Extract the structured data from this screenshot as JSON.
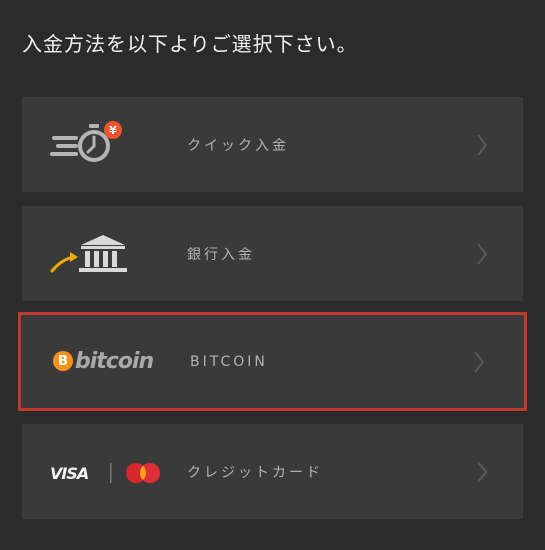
{
  "header": {
    "title": "入金方法を以下よりご選択下さい。"
  },
  "options": [
    {
      "label": "クイック入金",
      "icon": "quick-deposit-timer-yen-icon",
      "selected": false
    },
    {
      "label": "銀行入金",
      "icon": "bank-transfer-icon",
      "selected": false
    },
    {
      "label": "BITCOIN",
      "icon": "bitcoin-logo",
      "selected": true,
      "logo_symbol": "B",
      "logo_text": "bitcoin"
    },
    {
      "label": "クレジットカード",
      "icon": "visa-mastercard-icon",
      "selected": false,
      "visa_text": "VISA"
    }
  ],
  "colors": {
    "background": "#2b2b2b",
    "card": "#3a3a3a",
    "selected_border": "#c0392b",
    "bitcoin_orange": "#f7931a",
    "yen_badge": "#e8562a",
    "arrow_gold": "#f2a900"
  }
}
